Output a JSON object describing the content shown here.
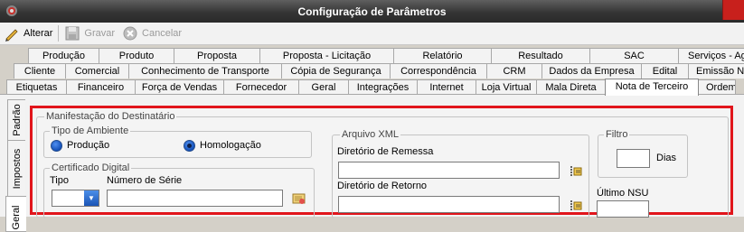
{
  "window": {
    "title": "Configuração de Parâmetros"
  },
  "toolbar": {
    "alterar": "Alterar",
    "gravar": "Gravar",
    "cancelar": "Cancelar"
  },
  "tabs": {
    "row1": [
      "Produção",
      "Produto",
      "Proposta",
      "Proposta - Licitação",
      "Relatório",
      "Resultado",
      "SAC",
      "Serviços - Agente"
    ],
    "row2": [
      "Cliente",
      "Comercial",
      "Conhecimento de Transporte",
      "Cópia de Segurança",
      "Correspondência",
      "CRM",
      "Dados da Empresa",
      "Edital",
      "Emissão N"
    ],
    "row3": [
      "Etiquetas",
      "Financeiro",
      "Força de Vendas",
      "Fornecedor",
      "Geral",
      "Integrações",
      "Internet",
      "Loja Virtual",
      "Mala Direta",
      "Nota de Terceiro",
      "Ordem de"
    ],
    "active": "Nota de Terceiro"
  },
  "sidetabs": [
    "Padrão",
    "Impostos",
    "Geral"
  ],
  "form": {
    "manifestacao": {
      "legend": "Manifestação do Destinatário",
      "tipo_ambiente": {
        "legend": "Tipo de Ambiente",
        "option1": "Produção",
        "option2": "Homologação",
        "selected": "Homologação"
      },
      "certificado": {
        "legend": "Certificado Digital",
        "tipo_label": "Tipo",
        "serie_label": "Número de Série",
        "tipo_value": "",
        "serie_value": ""
      },
      "arquivo_xml": {
        "legend": "Arquivo XML",
        "remessa_label": "Diretório de Remessa",
        "remessa_value": "",
        "retorno_label": "Diretório de Retorno",
        "retorno_value": ""
      },
      "filtro": {
        "legend": "Filtro",
        "dias_label": "Dias",
        "dias_value": ""
      },
      "ultimo_nsu": {
        "label": "Último NSU",
        "value": ""
      }
    }
  }
}
